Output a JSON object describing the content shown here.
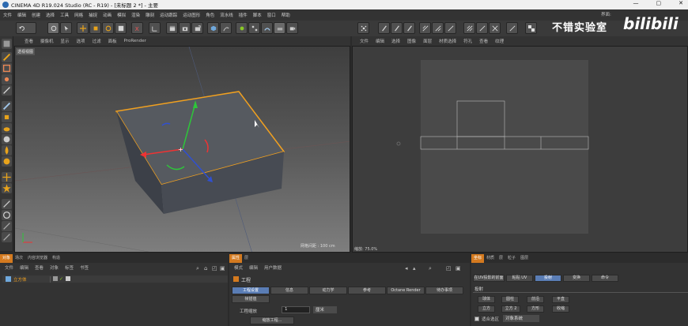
{
  "window": {
    "title": "CINEMA 4D R19.024 Studio (RC - R19) - [未标题 2 *] - 主要",
    "controls": [
      "—",
      "▢",
      "✕"
    ]
  },
  "menubar": {
    "items": [
      "文件",
      "编辑",
      "创建",
      "选择",
      "工具",
      "网格",
      "捕捉",
      "动画",
      "模拟",
      "渲染",
      "雕刻",
      "运动跟踪",
      "运动图形",
      "角色",
      "流水线",
      "插件",
      "脚本",
      "窗口",
      "帮助"
    ],
    "layout_label": "界面:"
  },
  "watermark": {
    "text": "不错实验室",
    "logo": "bilibili"
  },
  "viewport_left": {
    "menu": [
      "查看",
      "摄像机",
      "显示",
      "选项",
      "过滤",
      "面板",
      "ProRender"
    ],
    "camera_label": "透视视图",
    "grid_status": "网格间距 : 100 cm"
  },
  "viewport_right": {
    "menu": [
      "文件",
      "编辑",
      "选择",
      "图像",
      "面层",
      "材质选择",
      "符孔",
      "查看",
      "纹理"
    ],
    "zoom_status": "缩放: 75.0%"
  },
  "objects_panel": {
    "tabs": [
      "对象",
      "场次",
      "内容浏览器",
      "构造"
    ],
    "active_tab": 0,
    "menu": [
      "文件",
      "编辑",
      "查看",
      "对象",
      "标签",
      "书签"
    ],
    "rows": [
      {
        "name": "立方体"
      }
    ]
  },
  "attributes_panel": {
    "tabs": [
      "属性",
      "层"
    ],
    "active_tab": 0,
    "menu": [
      "模式",
      "编辑",
      "用户数据"
    ],
    "section_title": "工程",
    "buttons_row1": [
      "工程设置",
      "信息",
      "动力学",
      "参考",
      "Octane Render",
      "待办事项"
    ],
    "buttons_row2": [
      "帧插值"
    ],
    "field_label": "工程缩放",
    "field_value": "1",
    "field_unit": "厘米",
    "scale_button": "缩放工程..."
  },
  "coords_panel": {
    "tabs": [
      "坐标",
      "材质",
      "层",
      "粒子",
      "图层"
    ],
    "menu_buttons": [
      "在UV投影的前面",
      "粘贴 UV",
      "投射",
      "变换",
      "命令"
    ],
    "section_title": "投射",
    "proj_row1": [
      "球体",
      "圆柱",
      "前沿",
      "平直"
    ],
    "proj_row2": [
      "立方",
      "立方 2",
      "方形",
      "收缩"
    ],
    "checkbox_label": "适合选区",
    "dropdown_value": "对象系统"
  }
}
